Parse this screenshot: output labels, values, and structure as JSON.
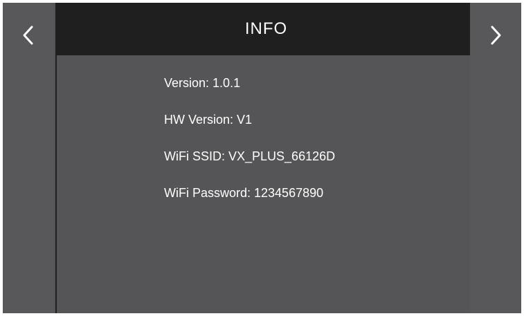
{
  "header": {
    "title": "INFO"
  },
  "nav": {
    "prev_icon": "chevron-left-icon",
    "next_icon": "chevron-right-icon"
  },
  "info": [
    "Version: 1.0.1",
    "HW Version: V1",
    "WiFi SSID: VX_PLUS_66126D",
    "WiFi Password: 1234567890"
  ],
  "colors": {
    "panel": "#555557",
    "header": "#1f1f1f",
    "text": "#ffffff"
  }
}
